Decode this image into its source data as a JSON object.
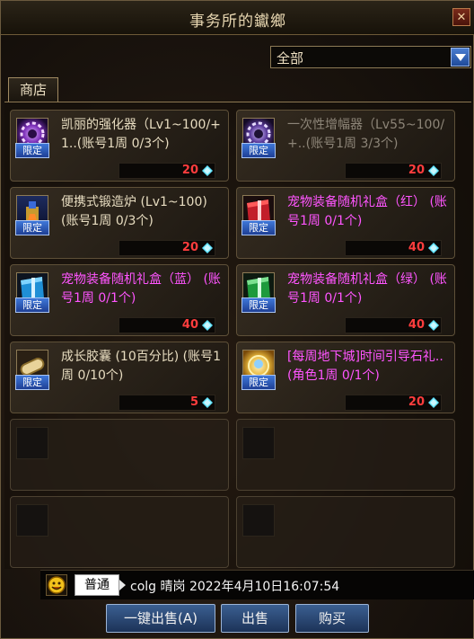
{
  "window": {
    "title": "事务所的钀鄉",
    "close_label": "✕"
  },
  "filter": {
    "selected": "全部"
  },
  "tabs": [
    {
      "label": "商店"
    }
  ],
  "currency": {
    "icon": "cera-gem-icon",
    "color": "#5fe3ff"
  },
  "items": [
    {
      "name": "凯丽的强化器（Lv1~100/+1..(账号1周 0/3个)",
      "badge": "限定",
      "price": "20",
      "name_color": "#e7dcc0",
      "icon": "enhancer-icon"
    },
    {
      "name": "一次性增幅器（Lv55~100/+..(账号1周 3/3个)",
      "badge": "限定",
      "price": "20",
      "name_color": "#8d8578",
      "icon": "amplifier-icon"
    },
    {
      "name": "便携式锻造炉 (Lv1~100) (账号1周 0/3个)",
      "badge": "限定",
      "price": "20",
      "name_color": "#e7dcc0",
      "icon": "forge-icon"
    },
    {
      "name": "宠物装备随机礼盒（红） (账号1周 0/1个)",
      "badge": "限定",
      "price": "40",
      "name_color": "#ff55ff",
      "icon": "red-gift-box-icon"
    },
    {
      "name": "宠物装备随机礼盒（蓝） (账号1周 0/1个)",
      "badge": "限定",
      "price": "40",
      "name_color": "#ff55ff",
      "icon": "blue-gift-box-icon"
    },
    {
      "name": "宠物装备随机礼盒（绿） (账号1周 0/1个)",
      "badge": "限定",
      "price": "40",
      "name_color": "#ff55ff",
      "icon": "green-gift-box-icon"
    },
    {
      "name": "成长胶囊 (10百分比) (账号1周 0/10个)",
      "badge": "限定",
      "price": "5",
      "name_color": "#e7dcc0",
      "icon": "growth-capsule-icon"
    },
    {
      "name": "[每周地下城]时间引导石礼..(角色1周 0/1个)",
      "badge": "限定",
      "price": "20",
      "name_color": "#ff55ff",
      "icon": "time-stone-gift-icon"
    }
  ],
  "chat": {
    "channel": "普通",
    "message": "colg 晴岗 2022年4月10日16:07:54"
  },
  "buttons": {
    "sell_all": "一键出售(A)",
    "sell": "出售",
    "buy": "购买"
  }
}
